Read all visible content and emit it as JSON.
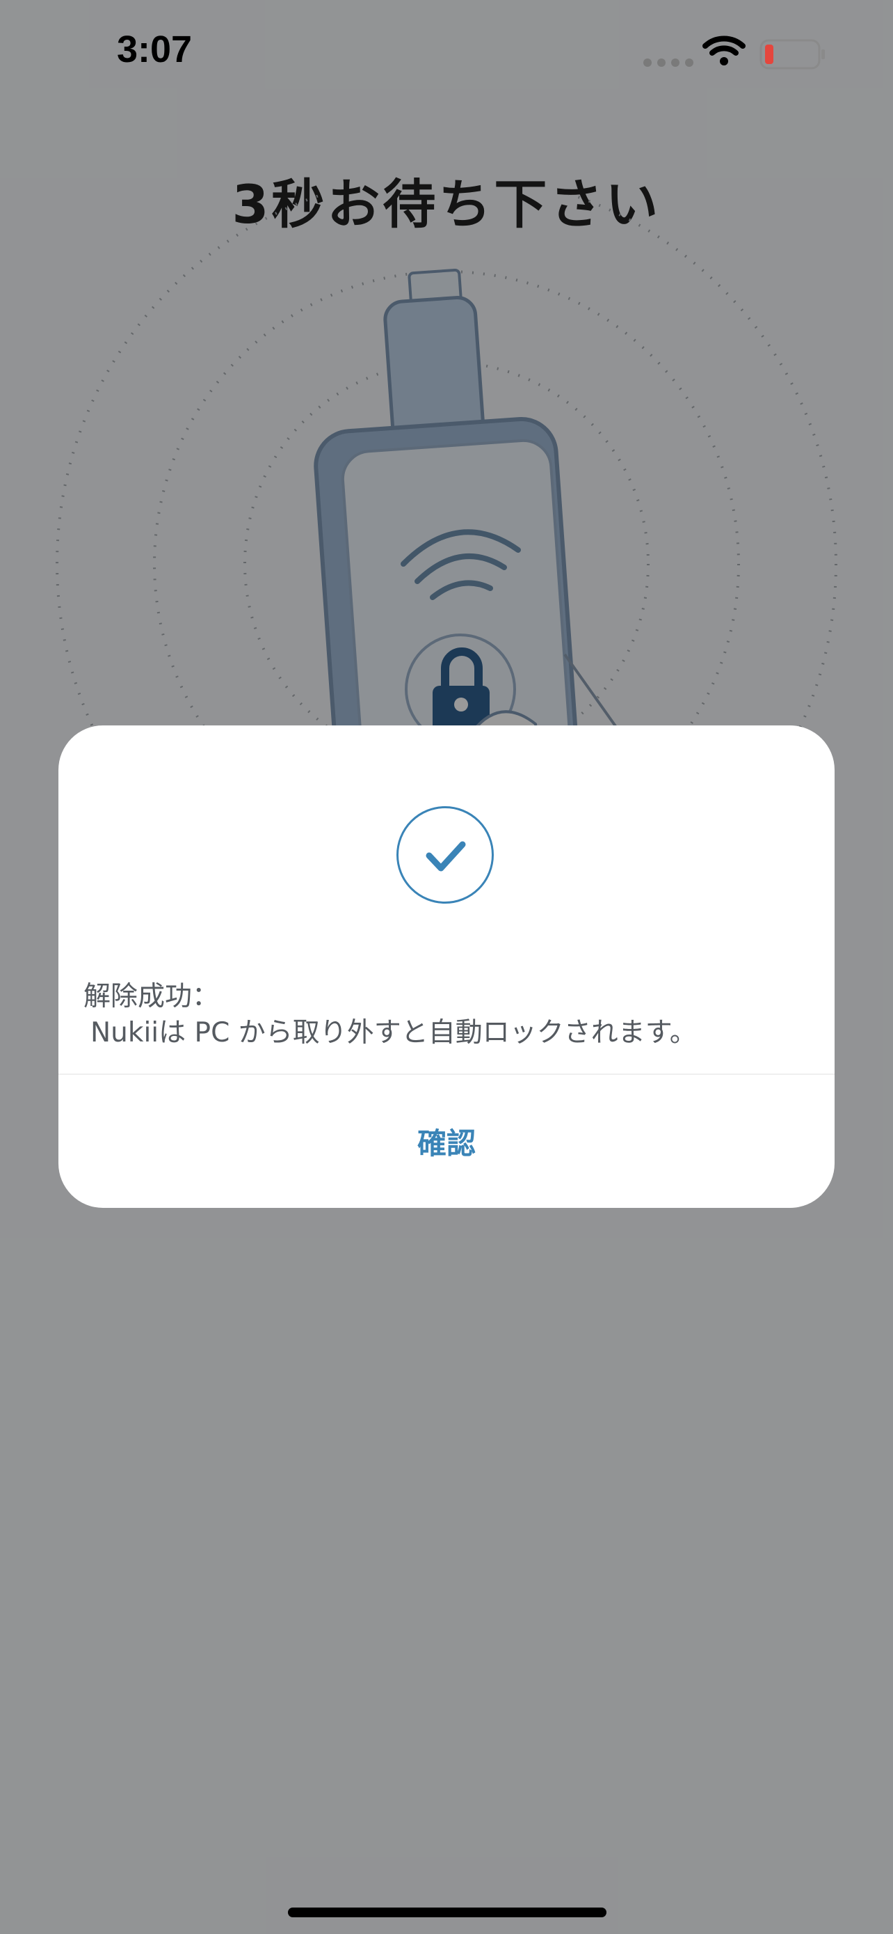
{
  "status_bar": {
    "time": "3:07",
    "battery_level": 0.1,
    "battery_color": "#e5463d",
    "wifi_icon": "wifi-icon",
    "signal_icon": "cellular-signal-icon"
  },
  "page": {
    "title": "3秒お待ち下さい",
    "illustration_icons": [
      "usb-key-icon",
      "phone-icon",
      "nfc-waves-icon",
      "padlock-icon",
      "hand-icon"
    ]
  },
  "dialog": {
    "icon": "check-circle-icon",
    "message_title": "解除成功：",
    "message_body": "Nukiiは PC から取り外すと自動ロックされます。",
    "confirm_label": "確認"
  },
  "colors": {
    "accent": "#3a84b7",
    "overlay": "rgba(0,0,0,0.4)",
    "dialog_background": "#ffffff",
    "text": "#555a60"
  }
}
